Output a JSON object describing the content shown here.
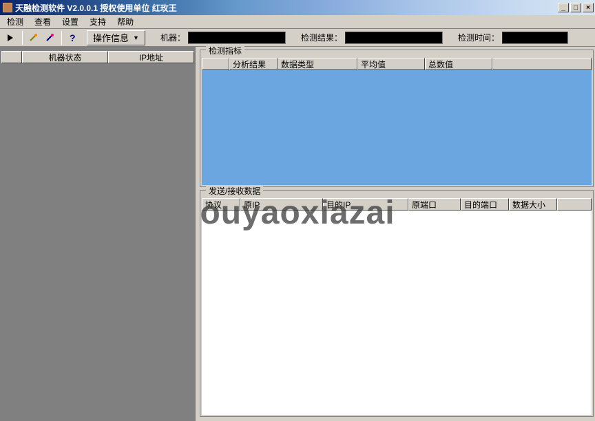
{
  "titlebar": {
    "title": "天融检测软件 V2.0.0.1 授权使用单位 红玫王"
  },
  "menubar": {
    "items": [
      "检测",
      "查看",
      "设置",
      "支持",
      "帮助"
    ]
  },
  "toolbar": {
    "dropdown": "操作信息",
    "label_machine": "机器：",
    "label_result": "检测结果：",
    "label_time": "检测时间："
  },
  "left": {
    "col1": "机器状态",
    "col2": "IP地址"
  },
  "group1": {
    "title": "检测指标",
    "cols": [
      "",
      "分析结果",
      "数据类型",
      "平均值",
      "总数值",
      ""
    ]
  },
  "group2": {
    "title": "发送/接收数据",
    "cols": [
      "协议",
      "原IP",
      "目的IP",
      "原端口",
      "目的端口",
      "数据大小",
      ""
    ]
  },
  "watermark": "ouyaoxiazai"
}
